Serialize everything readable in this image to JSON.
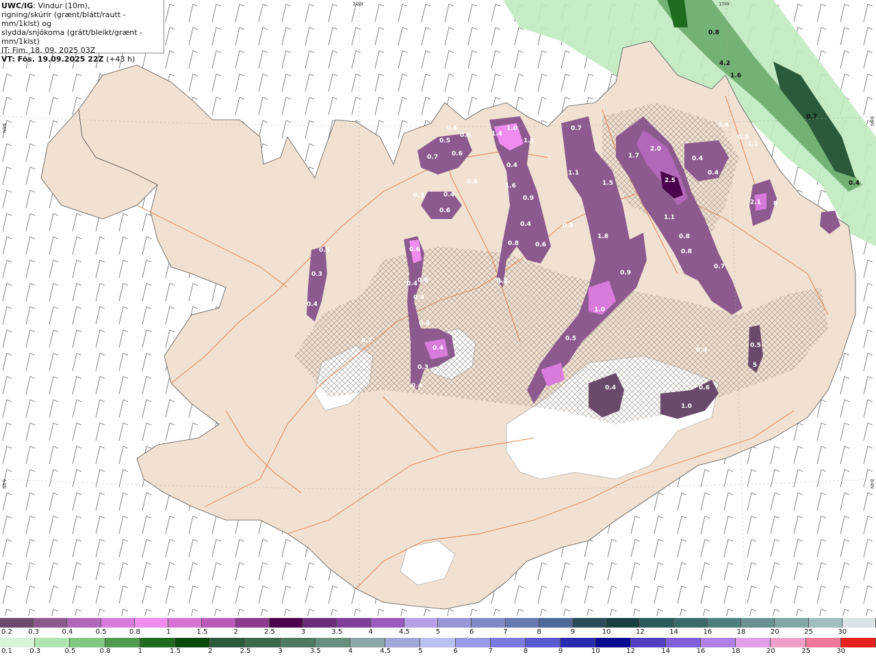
{
  "header": {
    "model": "UWC/IG",
    "line1": ": Vindur (10m),",
    "line2": "rigning/skúrir (grænt/blátt/rautt - mm/1klst) og",
    "line3": "slydda/snjókoma (grátt/bleikt/grænt - mm/1klst)",
    "it": "IT: Fim. 18. 09. 2025 03Z",
    "vt": "VT: Fös. 19.09.2025 22Z",
    "lead": "(+43 h)"
  },
  "grid_labels": {
    "lon_20w": "20W",
    "lon_15w": "15W",
    "lat_66n_left": "66N",
    "lat_66n_right": "66N",
    "lat_64n_left": "64N",
    "lat_64n_right": "64N"
  },
  "precip_labels": [
    "0.4",
    "0.5",
    "0.6",
    "0.7",
    "0.6",
    "0.6",
    "0.6",
    "0.3",
    "0.4",
    "0.6",
    "1.4",
    "1.0",
    "1.1",
    "0.4",
    "1.6",
    "0.9",
    "0.4",
    "0.8",
    "0.6",
    "0.3",
    "0.7",
    "1.1",
    "1.5",
    "0.5",
    "1.8",
    "0.9",
    "1.0",
    "0.5",
    "1.7",
    "2.0",
    "2.5",
    "1.1",
    "0.8",
    "0.8",
    "0.7",
    "0.4",
    "0.4",
    "2.1",
    "8",
    "1.1",
    "0.4",
    "0.5",
    "0.4",
    "0.6",
    "0.4",
    "0.3",
    "0.5",
    "0.3",
    "0.4",
    "0.7",
    "0.4",
    "0.4",
    "0.3",
    "0.4",
    "0.4",
    "1.0",
    "0.6",
    "0.9",
    "0.5",
    "5",
    "0.8",
    "4.2",
    "1.6",
    "0.7",
    "0.4"
  ],
  "legend_snow": {
    "labels": [
      "0.2",
      "0.3",
      "0.4",
      "0.5",
      "0.8",
      "1",
      "1.5",
      "2",
      "2.5",
      "3",
      "3.5",
      "4",
      "4.5",
      "5",
      "6",
      "7",
      "8",
      "9",
      "10",
      "12",
      "14",
      "16",
      "18",
      "20",
      "25",
      "30"
    ],
    "colors": [
      "#6a4a6b",
      "#8c5a8e",
      "#b168b8",
      "#d97bdd",
      "#f08cf0",
      "#d873d6",
      "#b95ab8",
      "#8e3a8e",
      "#4a004a",
      "#6a2a78",
      "#7e3e9a",
      "#9a5ac0",
      "#b4a0e6",
      "#9a96d8",
      "#7f88c8",
      "#6878b0",
      "#4e6898",
      "#2a4a5a",
      "#184040",
      "#2a5a5a",
      "#3a6a6a",
      "#4e7e7e",
      "#6a9292",
      "#82a6a6",
      "#a2bebe",
      "#d8e4e4"
    ]
  },
  "legend_rain": {
    "labels": [
      "0.1",
      "0.3",
      "0.5",
      "0.8",
      "1",
      "1.5",
      "2",
      "2.5",
      "3",
      "3.5",
      "4",
      "4.5",
      "5",
      "6",
      "7",
      "8",
      "9",
      "10",
      "12",
      "14",
      "16",
      "18",
      "20",
      "25",
      "30"
    ],
    "colors": [
      "#d8f4d8",
      "#b0e4b0",
      "#80c880",
      "#509a50",
      "#1e6a1e",
      "#0a4a0a",
      "#2a5a3a",
      "#3a6a4a",
      "#4e7a62",
      "#68907e",
      "#8aa8a8",
      "#a0a8d8",
      "#b8c0f0",
      "#9a9ae8",
      "#7a7ae0",
      "#5a5ad0",
      "#2a2ab0",
      "#0a0a90",
      "#5040c0",
      "#8060d8",
      "#b080e8",
      "#e0a0e8",
      "#f0a0c8",
      "#f07898",
      "#e82020"
    ]
  }
}
